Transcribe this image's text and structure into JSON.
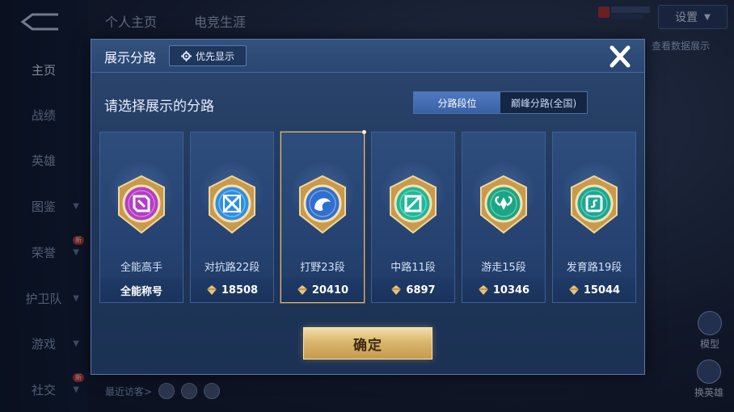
{
  "sidebar": {
    "items": [
      {
        "label": "主页",
        "active": true,
        "chevron": false,
        "badge": ""
      },
      {
        "label": "战绩",
        "active": false,
        "chevron": false,
        "badge": ""
      },
      {
        "label": "英雄",
        "active": false,
        "chevron": false,
        "badge": ""
      },
      {
        "label": "图鉴",
        "active": false,
        "chevron": true,
        "badge": ""
      },
      {
        "label": "荣誉",
        "active": false,
        "chevron": true,
        "badge": "新"
      },
      {
        "label": "护卫队",
        "active": false,
        "chevron": true,
        "badge": ""
      },
      {
        "label": "游戏",
        "active": false,
        "chevron": true,
        "badge": ""
      },
      {
        "label": "社交",
        "active": false,
        "chevron": true,
        "badge": "新"
      }
    ]
  },
  "topbar": {
    "tabs": [
      "个人主页",
      "电竞生涯"
    ],
    "settings_label": "设置",
    "data_link": "查看数据展示"
  },
  "bottom": {
    "visitors_label": "最近访客>",
    "model_label": "模型",
    "hero_label": "换英雄"
  },
  "dialog": {
    "title": "展示分路",
    "priority_label": "优先显示",
    "subtitle": "请选择展示的分路",
    "segments": [
      {
        "label": "分路段位",
        "active": true
      },
      {
        "label": "巅峰分路(全国)",
        "active": false
      }
    ],
    "cards": [
      {
        "label": "全能高手",
        "value": "全能称号",
        "selected": false,
        "color": "#b43cc8",
        "icon": "all-round-emblem-icon"
      },
      {
        "label": "对抗路22段",
        "value": "18508",
        "selected": false,
        "color": "#2f8fe0",
        "icon": "clash-lane-emblem-icon"
      },
      {
        "label": "打野23段",
        "value": "20410",
        "selected": true,
        "color": "#2f6fd0",
        "icon": "jungle-emblem-icon"
      },
      {
        "label": "中路11段",
        "value": "6897",
        "selected": false,
        "color": "#1fb89a",
        "icon": "mid-lane-emblem-icon"
      },
      {
        "label": "游走15段",
        "value": "10346",
        "selected": false,
        "color": "#1aa684",
        "icon": "roam-emblem-icon"
      },
      {
        "label": "发育路19段",
        "value": "15044",
        "selected": false,
        "color": "#1aa894",
        "icon": "farm-lane-emblem-icon"
      }
    ],
    "confirm_label": "确定"
  },
  "colors": {
    "gold": "#d9b66e",
    "panel": "#20385c",
    "accent_blue": "#4f79bf"
  }
}
